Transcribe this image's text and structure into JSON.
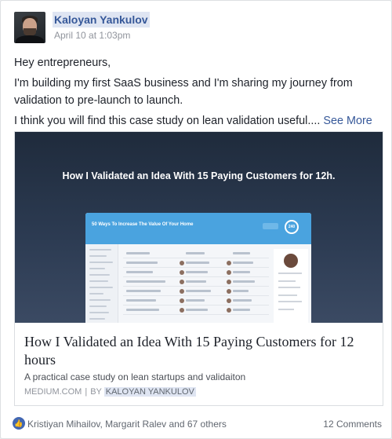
{
  "post": {
    "author": "Kaloyan Yankulov",
    "timestamp": "April 10 at 1:03pm",
    "paragraphs": [
      "Hey entrepreneurs,",
      "I'm building my first SaaS business and I'm sharing my journey from validation to pre-launch to launch.",
      "I think you will find this case study on lean validation useful...."
    ],
    "see_more": "See More"
  },
  "link_card": {
    "image_title": "How I Validated an Idea With 15 Paying Customers for 12h.",
    "mock_header": "50 Ways To Increase The Value Of Your Home",
    "mock_score": "240",
    "title": "How I Validated an Idea With 15 Paying Customers for 12 hours",
    "description": "A practical case study on lean startups and validaiton",
    "source": "MEDIUM.COM",
    "separator": "|",
    "by_label": "BY",
    "by_name": "KALOYAN YANKULOV"
  },
  "footer": {
    "like_icon": "thumbs-up-icon",
    "reactors": "Kristiyan Mihailov, Margarit Ralev and 67 others",
    "comments": "12 Comments"
  },
  "colors": {
    "link_blue": "#365899",
    "like_blue": "#4267b2",
    "mock_accent": "#4aa3df"
  }
}
